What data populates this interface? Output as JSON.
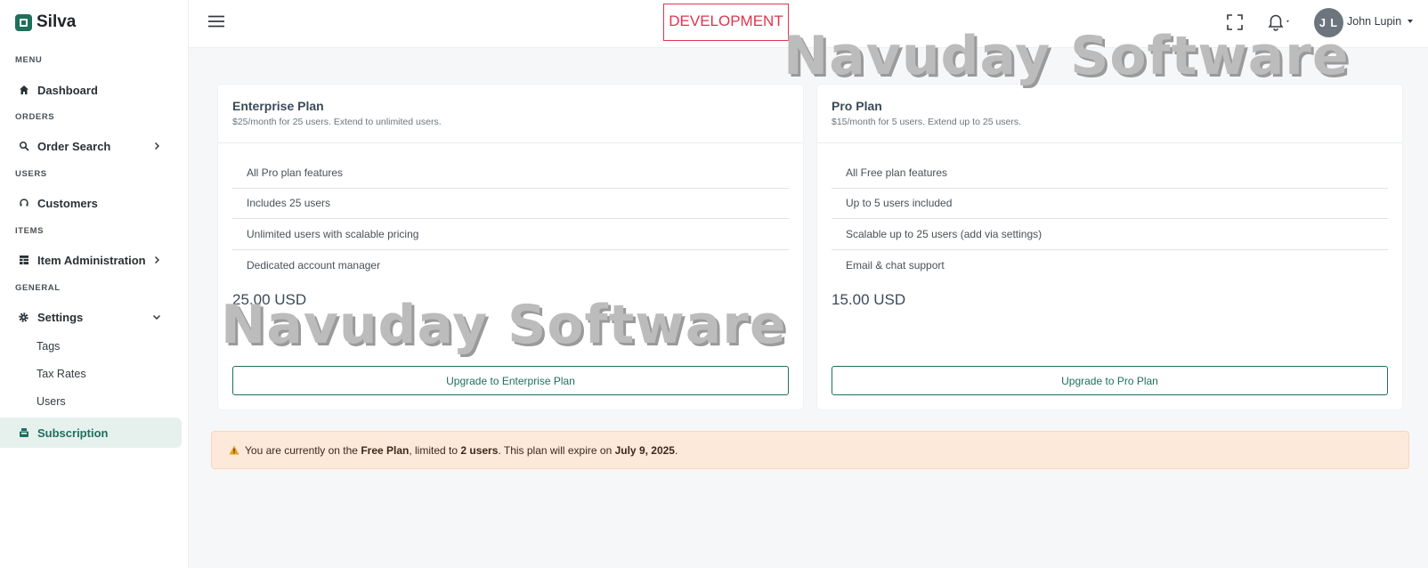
{
  "brand": {
    "name": "Silva"
  },
  "sidebar": {
    "sections": {
      "menu": "MENU",
      "orders": "ORDERS",
      "users": "USERS",
      "items": "ITEMS",
      "general": "GENERAL"
    },
    "items": {
      "dashboard": "Dashboard",
      "order_search": "Order Search",
      "customers": "Customers",
      "item_administration": "Item Administration",
      "settings": "Settings",
      "subscription": "Subscription"
    },
    "settings_children": [
      "Tags",
      "Tax Rates",
      "Users"
    ],
    "active_item": "Subscription"
  },
  "topbar": {
    "environment_badge": "DEVELOPMENT",
    "user": {
      "initials": "J L",
      "name": "John Lupin"
    }
  },
  "plans": [
    {
      "title": "Enterprise Plan",
      "description": "$25/month for 25 users. Extend to unlimited users.",
      "features": [
        "All Pro plan features",
        "Includes 25 users",
        "Unlimited users with scalable pricing",
        "Dedicated account manager"
      ],
      "price": "25.00 USD",
      "button": "Upgrade to Enterprise Plan"
    },
    {
      "title": "Pro Plan",
      "description": "$15/month for 5 users. Extend up to 25 users.",
      "features": [
        "All Free plan features",
        "Up to 5 users included",
        "Scalable up to 25 users (add via settings)",
        "Email & chat support"
      ],
      "price": "15.00 USD",
      "button": "Upgrade to Pro Plan"
    }
  ],
  "alert": {
    "prefix": "You are currently on the ",
    "plan": "Free Plan",
    "middle": ", limited to ",
    "limit": "2 users",
    "suffix": ". This plan will expire on ",
    "date": "July 9, 2025",
    "end": "."
  },
  "watermark": "Navuday Software",
  "colors": {
    "accent": "#1f6f5c",
    "dev_badge": "#e0344e",
    "alert_bg": "#fde9da"
  }
}
